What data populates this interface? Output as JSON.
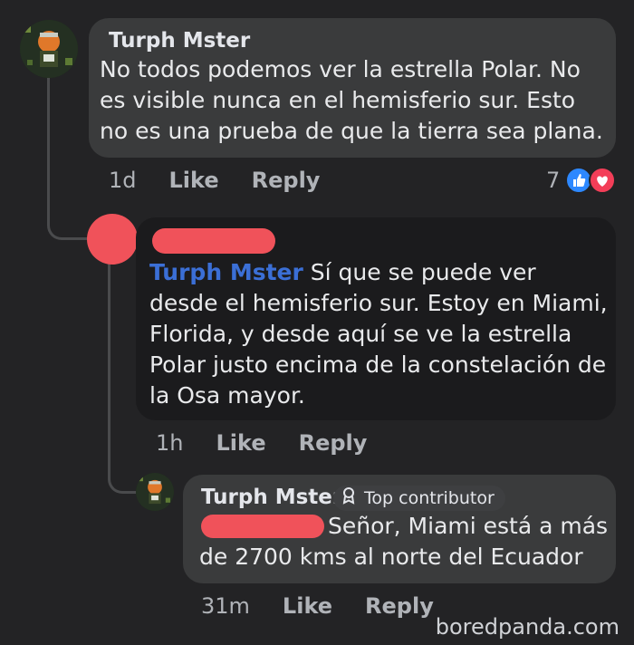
{
  "comment1": {
    "author": "Turph Mster",
    "text": "No todos podemos ver la estrella Polar. No es visible nunca en el hemisferio sur. Esto no es una prueba de que la tierra sea plana.",
    "time": "1d",
    "like_label": "Like",
    "reply_label": "Reply",
    "reaction_count": "7",
    "reactions": [
      "like-icon",
      "love-icon"
    ],
    "colors": {
      "like": "#2d88ff",
      "love": "#f33e58"
    }
  },
  "reply1": {
    "mention": "Turph Mster",
    "text": "Sí que se puede ver desde el hemisferio sur. Estoy en Miami, Florida, y desde aquí se ve la estrella Polar justo encima de la constelación de la Osa mayor.",
    "time": "1h",
    "like_label": "Like",
    "reply_label": "Reply"
  },
  "reply2": {
    "author": "Turph Mster",
    "badge": "Top contributor",
    "text": "Señor, Miami está a más de 2700 kms al norte del Ecuador",
    "time": "31m",
    "like_label": "Like",
    "reply_label": "Reply"
  },
  "watermark": "boredpanda.com"
}
